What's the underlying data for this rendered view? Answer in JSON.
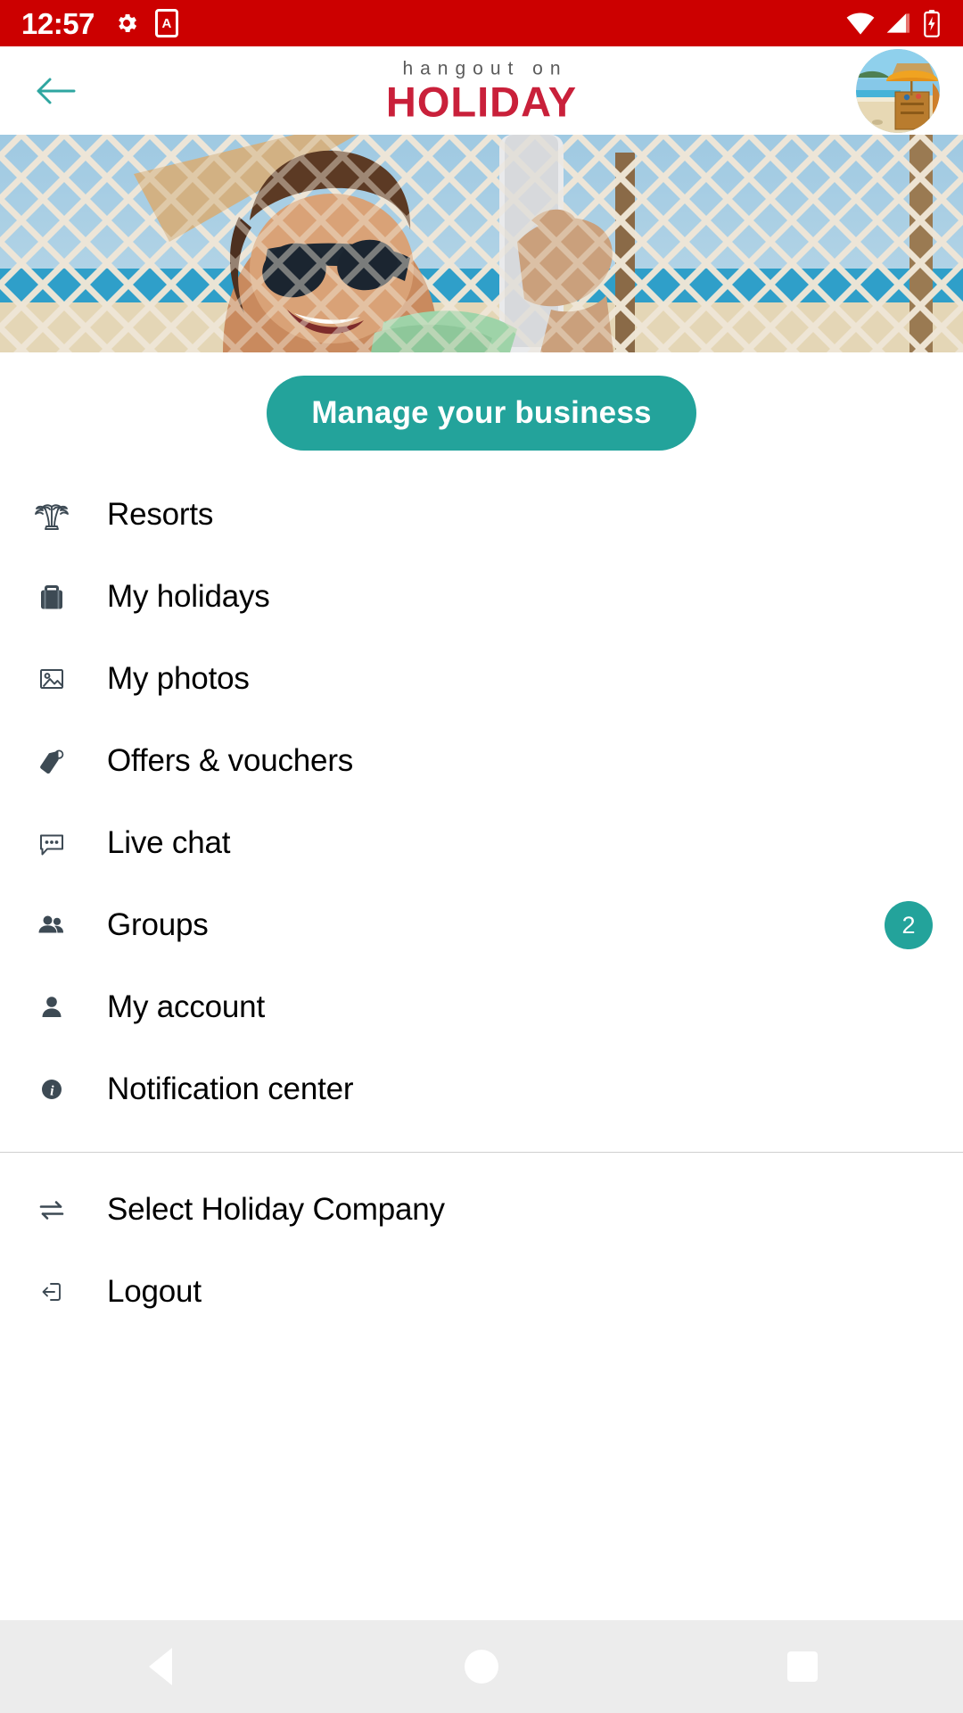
{
  "status_bar": {
    "time": "12:57",
    "background_color": "#CC0000",
    "left_icons": [
      {
        "name": "gear-icon",
        "label": "settings"
      },
      {
        "name": "app-badge-icon",
        "label": "A"
      }
    ],
    "right_icons": [
      {
        "name": "wifi-icon",
        "label": "wifi"
      },
      {
        "name": "cellular-signal-icon",
        "label": "signal"
      },
      {
        "name": "battery-charging-icon",
        "label": "battery"
      }
    ]
  },
  "header": {
    "back_label": "Back",
    "brand_sub": "hangout on",
    "brand_main": "HOLIDAY",
    "brand_sub_color": "#5B5B5B",
    "brand_main_color": "#C9203A",
    "avatar_alt": "Beach bar profile photo"
  },
  "hero": {
    "alt": "Woman in sunglasses relaxing in a hammock holding a phone"
  },
  "cta": {
    "label": "Manage your business",
    "color": "#23A39B"
  },
  "menu": {
    "primary_items": [
      {
        "icon": "palm-tree-icon",
        "label": "Resorts",
        "badge": null
      },
      {
        "icon": "suitcase-icon",
        "label": "My holidays",
        "badge": null
      },
      {
        "icon": "photo-icon",
        "label": "My photos",
        "badge": null
      },
      {
        "icon": "tag-icon",
        "label": "Offers & vouchers",
        "badge": null
      },
      {
        "icon": "chat-bubble-icon",
        "label": "Live chat",
        "badge": null
      },
      {
        "icon": "people-icon",
        "label": "Groups",
        "badge": "2"
      },
      {
        "icon": "person-icon",
        "label": "My account",
        "badge": null
      },
      {
        "icon": "info-icon",
        "label": "Notification center",
        "badge": null
      }
    ],
    "secondary_items": [
      {
        "icon": "swap-arrows-icon",
        "label": "Select Holiday Company",
        "badge": null
      },
      {
        "icon": "logout-icon",
        "label": "Logout",
        "badge": null
      }
    ],
    "badge_color": "#23A39B"
  },
  "nav_bar": {
    "back_label": "Back",
    "home_label": "Home",
    "recents_label": "Recents"
  }
}
